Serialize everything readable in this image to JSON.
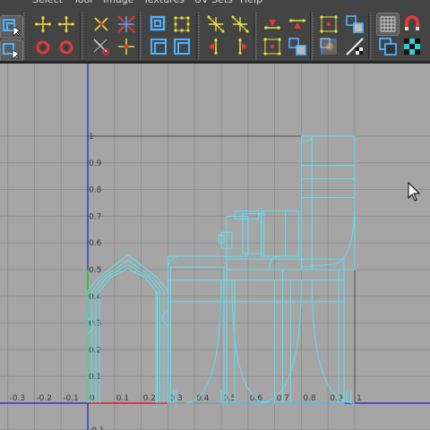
{
  "menu": {
    "items": [
      "Select",
      "Tool",
      "Image",
      "Textures",
      "UV Sets",
      "Help"
    ]
  },
  "toolbar": {
    "groups": [
      {
        "name": "selection-modes",
        "tools": [
          "uv-select-icon",
          "uv-shell-select-icon",
          "rotate-ccw-icon",
          "rotate-cw-icon"
        ]
      },
      {
        "name": "flip-tools",
        "tools": [
          "flip-horizontal-icon",
          "flip-vertical-icon",
          "align-icon",
          "distribute-icon"
        ]
      },
      {
        "name": "cut-sew",
        "tools": [
          "cut-uv-icon",
          "split-uv-icon",
          "sew-uv-icon",
          "merge-uv-icon"
        ]
      },
      {
        "name": "layout",
        "tools": [
          "unfold-icon",
          "relax-icon",
          "layout-icon",
          "grid-uv-icon"
        ]
      },
      {
        "name": "move-align",
        "tools": [
          "move-left-icon",
          "move-right-icon",
          "move-down-icon",
          "move-up-icon"
        ]
      },
      {
        "name": "shell-ops",
        "tools": [
          "select-shell-icon",
          "shell-border-icon",
          "shell-grid-icon",
          "shell-pack-icon"
        ]
      },
      {
        "name": "image",
        "tools": [
          "display-image-icon",
          "checker-toggle-icon",
          "dim-image-icon"
        ]
      },
      {
        "name": "grid-snap",
        "tools": [
          "grid-icon",
          "magnet-snap-icon",
          "shaded-uv-icon",
          "checker-map-icon"
        ]
      }
    ],
    "accent_blue": "#4db3ff",
    "accent_red": "#e03a3a",
    "accent_yellow": "#e8e23a"
  },
  "uv_editor": {
    "x_ticks": [
      "-0.3",
      "-0.2",
      "-0.1",
      "0",
      "0.1",
      "0.2",
      "0.3",
      "0.4",
      "0.5",
      "0.6",
      "0.7",
      "0.8",
      "0.9",
      "1"
    ],
    "y_ticks": [
      "1",
      "0.9",
      "0.8",
      "0.7",
      "0.6",
      "0.5",
      "0.4",
      "0.3",
      "0.2",
      "0.1",
      "-0.1"
    ],
    "colors": {
      "background": "#a5a5a5",
      "grid": "#8e8e8e",
      "wireframe": "#5fe1f2",
      "u_axis": "#e02a2a",
      "v_axis": "#1e1ec8",
      "v_axis_green": "#20d020"
    }
  }
}
